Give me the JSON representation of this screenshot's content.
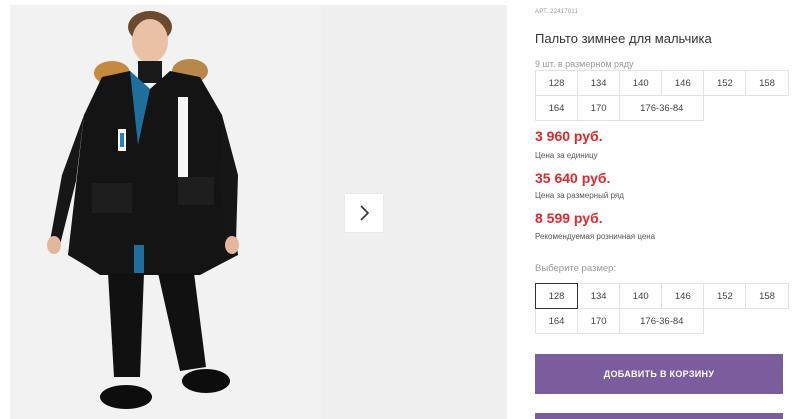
{
  "product": {
    "article_label": "АРТ.",
    "article_value": "22417011",
    "title": "Пальто зимнее для мальчика",
    "pack_note": "9 шт. в размерном ряду",
    "pack_sizes": [
      "128",
      "134",
      "140",
      "146",
      "152",
      "158",
      "164",
      "170",
      "176-36-84"
    ],
    "prices": [
      {
        "value": "3 960 руб.",
        "note": "Цена за единицу"
      },
      {
        "value": "35 640 руб.",
        "note": "Цена за размерный ряд"
      },
      {
        "value": "8 599 руб.",
        "note": "Рекомендуемая розничная цена"
      }
    ],
    "choose_size_label": "Выберите размер:",
    "sizes": [
      "128",
      "134",
      "140",
      "146",
      "152",
      "158",
      "164",
      "170",
      "176-36-84"
    ],
    "selected_size": "128",
    "add_to_cart": "Добавить в корзину"
  },
  "gallery": {
    "next_icon": "chevron-right-icon"
  },
  "colors": {
    "price": "#e0282e",
    "button": "#7b5d9d",
    "border": "#e3e3e3"
  }
}
